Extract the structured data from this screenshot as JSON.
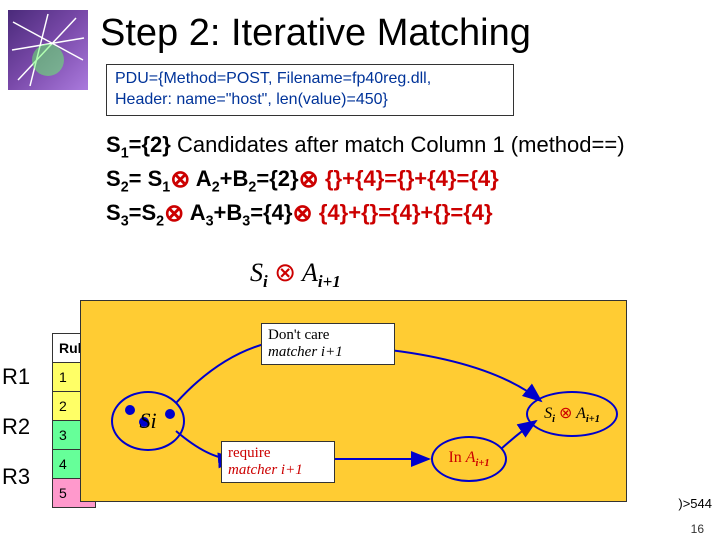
{
  "title": "Step 2: Iterative Matching",
  "pdu": {
    "line1": "PDU={Method=POST, Filename=fp40reg.dll,",
    "line2": "Header: name=\"host\", len(value)=450}"
  },
  "sets": {
    "s1_lhs": "S",
    "s1_sub": "1",
    "s1_eq": "={2}",
    "s1_tail": " Candidates after match Column 1 (method==)",
    "s2": "S",
    "s2sub": "2",
    "s2_mid1": "= S",
    "s2sub1": "1",
    "s2_a": " A",
    "s2asub": "2",
    "s2_b": "+B",
    "s2bsub": "2",
    "s2_rhs": "={2}",
    "s2_tail": " {}+{4}={}+{4}={4}",
    "s3": "S",
    "s3sub": "3",
    "s3_mid1": "=S",
    "s3sub1": "2",
    "s3_a": " A",
    "s3asub": "3",
    "s3_b": "+B",
    "s3bsub": "3",
    "s3_rhs": "={4}",
    "s3_tail": " {4}+{}={4}+{}={4}"
  },
  "formula_top": "Sᵢ ⊗ Aᵢ₊₁",
  "diagram": {
    "si_label": "Si",
    "dontcare_l1": "Don't care",
    "dontcare_l2": "matcher i+1",
    "require_l1": "require",
    "require_l2": "matcher i+1",
    "in_a_prefix": "In ",
    "in_a_var": "A",
    "in_a_sub": "i+1",
    "result_s": "S",
    "result_ssub": "i",
    "result_otimes": "⊗",
    "result_a": "A",
    "result_asub": "i+1"
  },
  "table": {
    "header": "Rule",
    "rows": [
      "1",
      "2",
      "3",
      "4",
      "5"
    ]
  },
  "r_labels": [
    "R1",
    "R2",
    "R3"
  ],
  "page_num": "16",
  "peek_right": ")>544"
}
